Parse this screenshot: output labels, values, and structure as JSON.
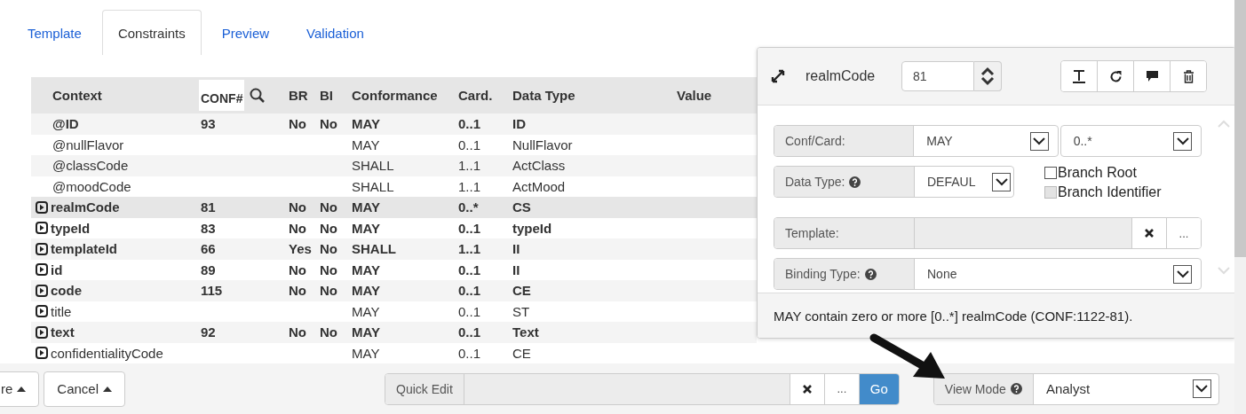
{
  "tabs": [
    {
      "label": "Template",
      "selected": false
    },
    {
      "label": "Constraints",
      "selected": true
    },
    {
      "label": "Preview",
      "selected": false
    },
    {
      "label": "Validation",
      "selected": false
    }
  ],
  "table": {
    "columns": [
      "Context",
      "CONF#",
      "BR",
      "BI",
      "Conformance",
      "Card.",
      "Data Type",
      "Value"
    ],
    "rows": [
      {
        "context": "@ID",
        "conf": "93",
        "br": "No",
        "bi": "No",
        "conformance": "MAY",
        "card": "0..1",
        "data_type": "ID",
        "kind": "constrained",
        "expandable": false,
        "selected": false
      },
      {
        "context": "@nullFlavor",
        "conformance": "MAY",
        "card": "0..1",
        "data_type": "NullFlavor",
        "kind": "plain",
        "expandable": false,
        "selected": false
      },
      {
        "context": "@classCode",
        "conformance": "SHALL",
        "card": "1..1",
        "data_type": "ActClass",
        "kind": "plain",
        "expandable": false,
        "selected": false
      },
      {
        "context": "@moodCode",
        "conformance": "SHALL",
        "card": "1..1",
        "data_type": "ActMood",
        "kind": "plain",
        "expandable": false,
        "selected": false
      },
      {
        "context": "realmCode",
        "conf": "81",
        "br": "No",
        "bi": "No",
        "conformance": "MAY",
        "card": "0..*",
        "data_type": "CS",
        "kind": "constrained",
        "expandable": true,
        "selected": true
      },
      {
        "context": "typeId",
        "conf": "83",
        "br": "No",
        "bi": "No",
        "conformance": "MAY",
        "card": "0..1",
        "data_type": "typeId",
        "kind": "constrained",
        "expandable": true,
        "selected": false
      },
      {
        "context": "templateId",
        "conf": "66",
        "br": "Yes",
        "bi": "No",
        "conformance": "SHALL",
        "card": "1..1",
        "data_type": "II",
        "kind": "constrained",
        "expandable": true,
        "selected": false
      },
      {
        "context": "id",
        "conf": "89",
        "br": "No",
        "bi": "No",
        "conformance": "MAY",
        "card": "0..1",
        "data_type": "II",
        "kind": "constrained",
        "expandable": true,
        "selected": false
      },
      {
        "context": "code",
        "conf": "115",
        "br": "No",
        "bi": "No",
        "conformance": "MAY",
        "card": "0..1",
        "data_type": "CE",
        "kind": "constrained",
        "expandable": true,
        "selected": false
      },
      {
        "context": "title",
        "conformance": "MAY",
        "card": "0..1",
        "data_type": "ST",
        "kind": "plain",
        "expandable": true,
        "selected": false
      },
      {
        "context": "text",
        "conf": "92",
        "br": "No",
        "bi": "No",
        "conformance": "MAY",
        "card": "0..1",
        "data_type": "Text",
        "kind": "constrained",
        "expandable": true,
        "selected": false
      },
      {
        "context": "confidentialityCode",
        "conformance": "MAY",
        "card": "0..1",
        "data_type": "CE",
        "kind": "plain",
        "expandable": true,
        "selected": false
      }
    ]
  },
  "panel": {
    "title": "realmCode",
    "number": "81",
    "conf_card": {
      "label": "Conf/Card:",
      "conformance": "MAY",
      "cardinality": "0..*"
    },
    "data_type": {
      "label": "Data Type:",
      "value": "DEFAUL"
    },
    "checkboxes": [
      {
        "label": "Branch Root",
        "checked": false,
        "disabled": false
      },
      {
        "label": "Branch Identifier",
        "checked": false,
        "disabled": true
      }
    ],
    "template": {
      "label": "Template:",
      "browse": "..."
    },
    "binding_type": {
      "label": "Binding Type:",
      "value": "None"
    },
    "summary": "MAY contain zero or more [0..*] realmCode (CONF:1122-81)."
  },
  "footer": {
    "buttons": [
      "re",
      "Cancel"
    ],
    "quick_edit": {
      "label": "Quick Edit",
      "browse": "...",
      "go": "Go"
    },
    "view_mode": {
      "label": "View Mode",
      "value": "Analyst"
    }
  }
}
